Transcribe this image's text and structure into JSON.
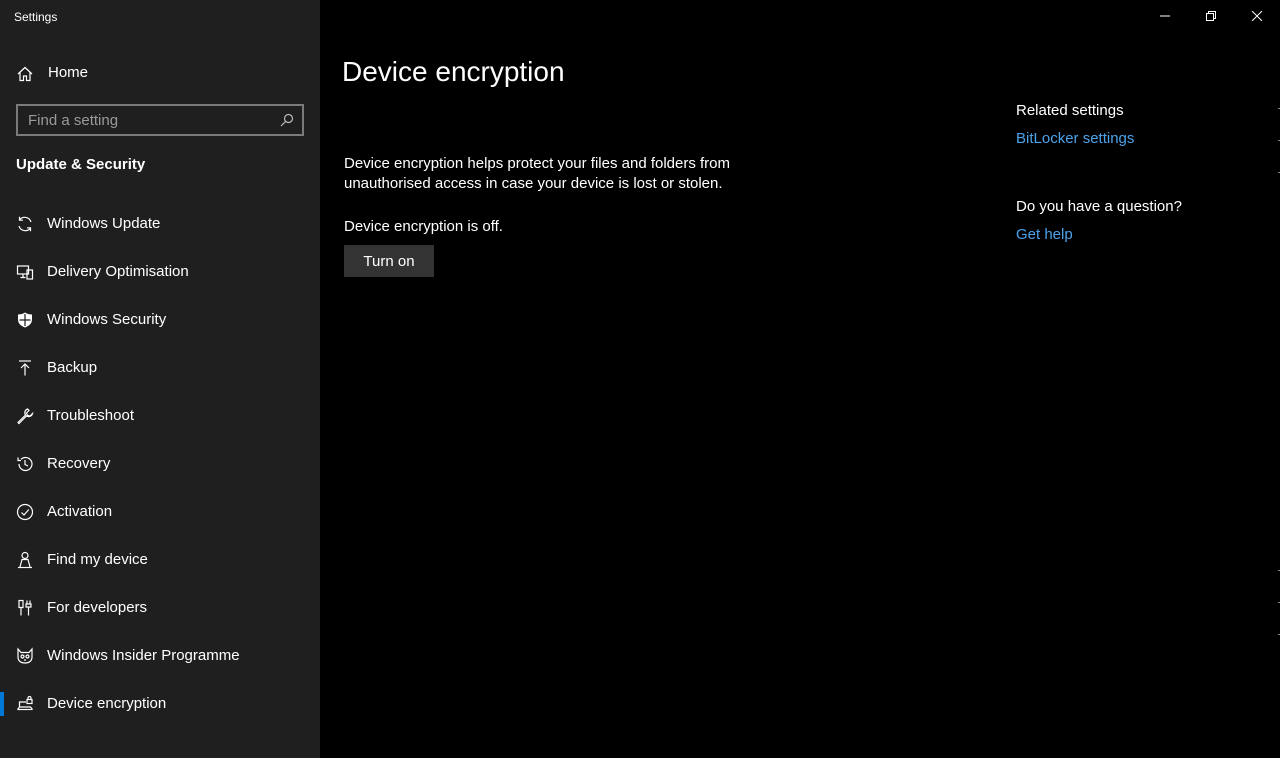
{
  "window": {
    "title": "Settings"
  },
  "sidebar": {
    "home_label": "Home",
    "search_placeholder": "Find a setting",
    "section_title": "Update & Security",
    "items": [
      {
        "label": "Windows Update",
        "icon": "sync-icon"
      },
      {
        "label": "Delivery Optimisation",
        "icon": "delivery-optimisation-icon"
      },
      {
        "label": "Windows Security",
        "icon": "shield-icon"
      },
      {
        "label": "Backup",
        "icon": "backup-arrow-icon"
      },
      {
        "label": "Troubleshoot",
        "icon": "wrench-icon"
      },
      {
        "label": "Recovery",
        "icon": "history-icon"
      },
      {
        "label": "Activation",
        "icon": "check-circle-icon"
      },
      {
        "label": "Find my device",
        "icon": "person-location-icon"
      },
      {
        "label": "For developers",
        "icon": "developer-tools-icon"
      },
      {
        "label": "Windows Insider Programme",
        "icon": "insider-cat-icon"
      },
      {
        "label": "Device encryption",
        "icon": "laptop-lock-icon",
        "active": true
      }
    ]
  },
  "main": {
    "title": "Device encryption",
    "description": "Device encryption helps protect your files and folders from unauthorised access in case your device is lost or stolen.",
    "status": "Device encryption is off.",
    "turn_on_label": "Turn on"
  },
  "related": {
    "heading": "Related settings",
    "bitlocker_link": "BitLocker settings",
    "question_heading": "Do you have a question?",
    "help_link": "Get help"
  },
  "colors": {
    "accent": "#0078d7",
    "link": "#4ba3ec",
    "sidebar_bg": "#1f1f1f",
    "main_bg": "#000000",
    "button_bg": "#333333"
  }
}
